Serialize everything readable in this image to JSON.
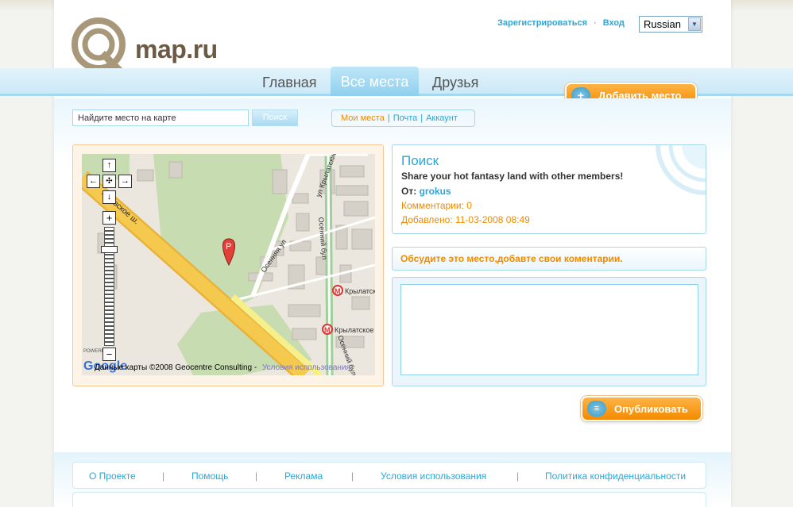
{
  "header": {
    "logo_text": "map.ru",
    "register_link": "Зарегистрироваться",
    "separator": "·",
    "login_link": "Вход",
    "language": "Russian"
  },
  "nav": {
    "items": [
      {
        "label": "Главная"
      },
      {
        "label": "Все места"
      },
      {
        "label": "Друзья"
      }
    ],
    "add_place_label": "Добавить место"
  },
  "search": {
    "placeholder": "Найдите место на карте",
    "button_label": "Поиск"
  },
  "account_links": {
    "my_places": "Мои места",
    "sep": "|",
    "mail": "Почта",
    "account": "Аккаунт"
  },
  "map": {
    "road_label": "...левское ш.",
    "streets": [
      "ул Крылатские Х",
      "Осенний бул",
      "Осенняя ул",
      "Осенний бул"
    ],
    "metro_labels": [
      "Крылатск",
      "Крылатское"
    ],
    "marker_letter": "P",
    "attribution": "Данные карты ©2008 Geocentre Consulting -",
    "terms_link": "Условия использования",
    "powered_by": "POWERED BY",
    "google_logo": "Google"
  },
  "place": {
    "title": "Поиск",
    "description": "Share your hot fantasy land with other members!",
    "from_label": "От:",
    "from_user": "grokus",
    "comments": "Комментарии: 0",
    "added": "Добавлено: 11-03-2008 08:49"
  },
  "discussion": {
    "prompt": "Обсудите это место,добавте свои коментарии.",
    "publish_label": "Опубликовать"
  },
  "footer": {
    "links": [
      "О Проекте",
      "Помощь",
      "Реклама",
      "Условия использования",
      "Политика конфиденциальности"
    ],
    "separator": "|"
  },
  "colors": {
    "accent_blue": "#2aa7d8",
    "accent_orange": "#f08a00"
  }
}
